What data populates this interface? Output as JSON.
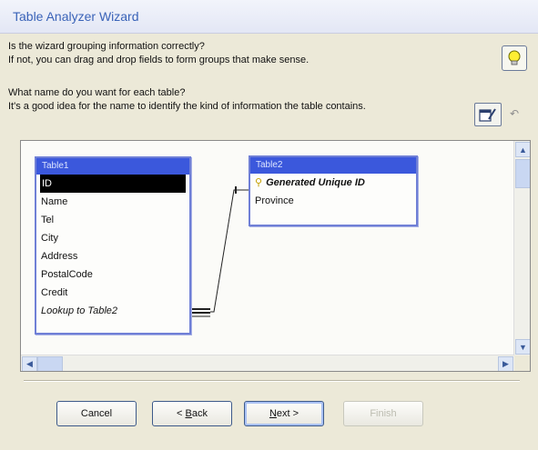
{
  "window": {
    "title": "Table Analyzer Wizard"
  },
  "instructions": {
    "line1": "Is the wizard grouping information correctly?",
    "line2": "If not, you can drag and drop fields to form groups that make sense.",
    "line3": "What name do you want for each table?",
    "line4": "It's a good idea for the name to identify the kind of information the table contains."
  },
  "icons": {
    "hint": "lightbulb-icon",
    "rename": "rename-table-icon",
    "undo": "undo-icon",
    "key": "primary-key-icon"
  },
  "undo_glyph": "↶",
  "tables": [
    {
      "name": "Table1",
      "fields": [
        "ID",
        "Name",
        "Tel",
        "City",
        "Address",
        "PostalCode",
        "Credit",
        "Lookup to Table2"
      ]
    },
    {
      "name": "Table2",
      "fields": [
        "Generated Unique ID",
        "Province"
      ]
    }
  ],
  "buttons": {
    "cancel": "Cancel",
    "back_prefix": "< ",
    "back_access": "B",
    "back_rest": "ack",
    "next_access": "N",
    "next_rest": "ext >",
    "finish": "Finish"
  },
  "colors": {
    "table_title_bg": "#3b58dc",
    "table_border": "#6f7fd6",
    "title_text": "#3a63b8"
  }
}
